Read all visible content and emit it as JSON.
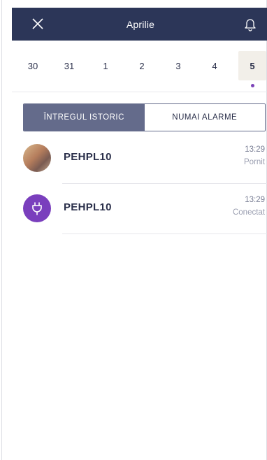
{
  "header": {
    "title": "Aprilie"
  },
  "dates": [
    "30",
    "31",
    "1",
    "2",
    "3",
    "4",
    "5"
  ],
  "selected_date": "5",
  "filters": {
    "all_history": "ÎNTREGUL ISTORIC",
    "only_alarms": "NUMAI ALARME"
  },
  "events": [
    {
      "device": "PEHPL10",
      "time": "13:29",
      "status": "Pornit",
      "avatar": "photo"
    },
    {
      "device": "PEHPL10",
      "time": "13:29",
      "status": "Conectat",
      "avatar": "plug-icon"
    }
  ],
  "colors": {
    "header_bg": "#2c3658",
    "accent": "#7a3fbd",
    "segment_active": "#646b8b",
    "selected_date_bg": "#f2efe9"
  }
}
